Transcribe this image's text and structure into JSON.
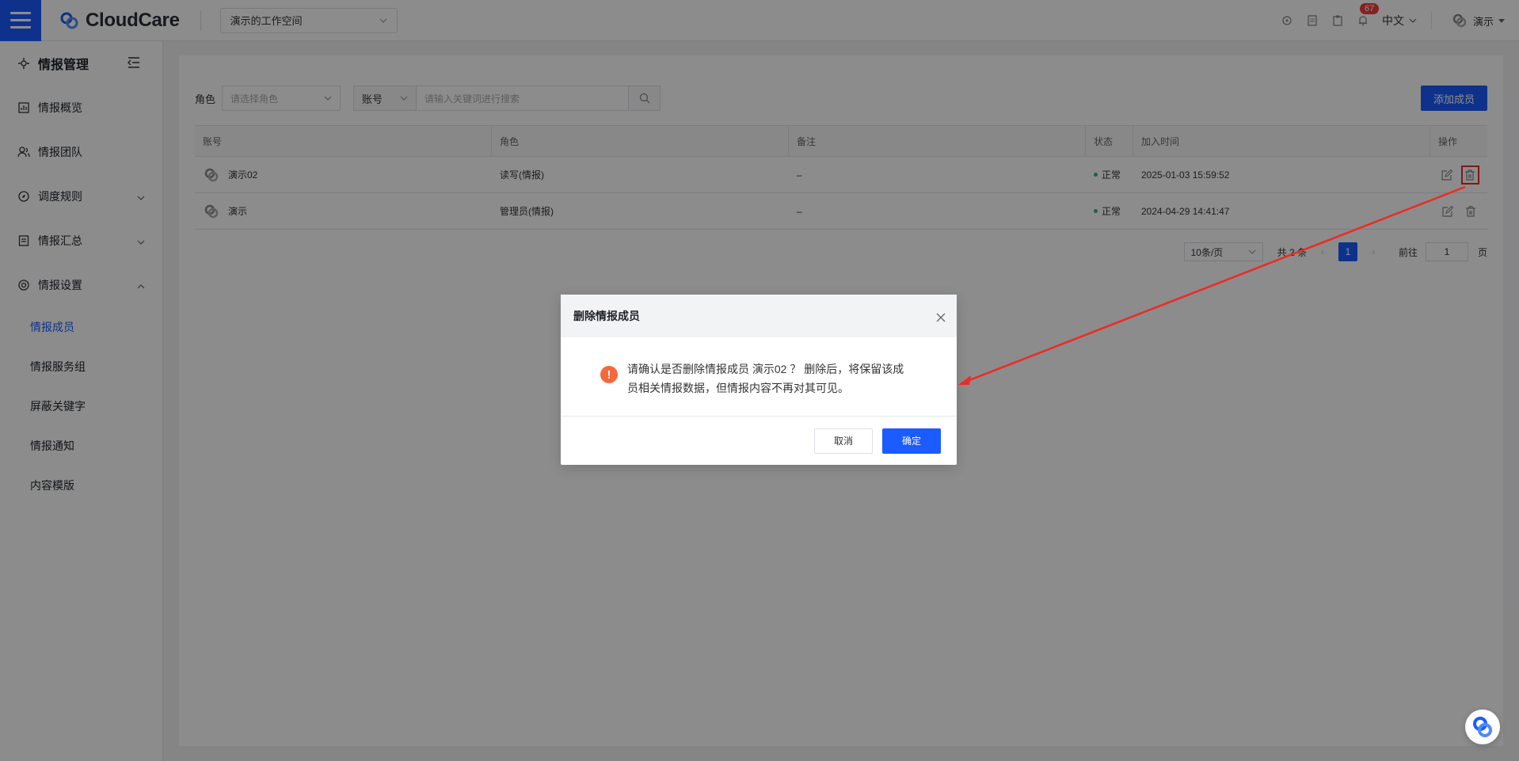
{
  "topbar": {
    "logo_text": "CloudCare",
    "workspace": "演示的工作空间",
    "notification_count": "67",
    "language": "中文",
    "user_name": "演示",
    "colors": {
      "brand": "#1a5cff",
      "badge": "#f23c3c"
    }
  },
  "sidebar": {
    "title": "情报管理",
    "items": [
      {
        "label": "情报概览",
        "icon": "chart-icon"
      },
      {
        "label": "情报团队",
        "icon": "team-icon"
      },
      {
        "label": "调度规则",
        "icon": "compass-icon",
        "expandable": true
      },
      {
        "label": "情报汇总",
        "icon": "document-icon",
        "expandable": true
      },
      {
        "label": "情报设置",
        "icon": "settings-icon",
        "expanded": true
      }
    ],
    "subitems": [
      {
        "label": "情报成员",
        "active": true
      },
      {
        "label": "情报服务组"
      },
      {
        "label": "屏蔽关键字"
      },
      {
        "label": "情报通知"
      },
      {
        "label": "内容模版"
      }
    ]
  },
  "filters": {
    "role_label": "角色",
    "role_placeholder": "请选择角色",
    "account_select": "账号",
    "keyword_placeholder": "请输入关键词进行搜索",
    "add_button": "添加成员"
  },
  "table": {
    "headers": [
      "账号",
      "角色",
      "备注",
      "状态",
      "加入时间",
      "操作"
    ],
    "rows": [
      {
        "account": "演示02",
        "role": "读写(情报)",
        "note": "–",
        "status": "正常",
        "joined": "2025-01-03 15:59:52"
      },
      {
        "account": "演示",
        "role": "管理员(情报)",
        "note": "–",
        "status": "正常",
        "joined": "2024-04-29 14:41:47"
      }
    ]
  },
  "pagination": {
    "page_size": "10条/页",
    "total": "共 2 条",
    "current_page": "1",
    "goto_label": "前往",
    "goto_value": "1",
    "page_suffix": "页"
  },
  "dialog": {
    "title": "删除情报成员",
    "message": "请确认是否删除情报成员 演示02 ？ 删除后，将保留该成员相关情报数据，但情报内容不再对其可见。",
    "cancel": "取消",
    "confirm": "确定",
    "warn_symbol": "!"
  }
}
